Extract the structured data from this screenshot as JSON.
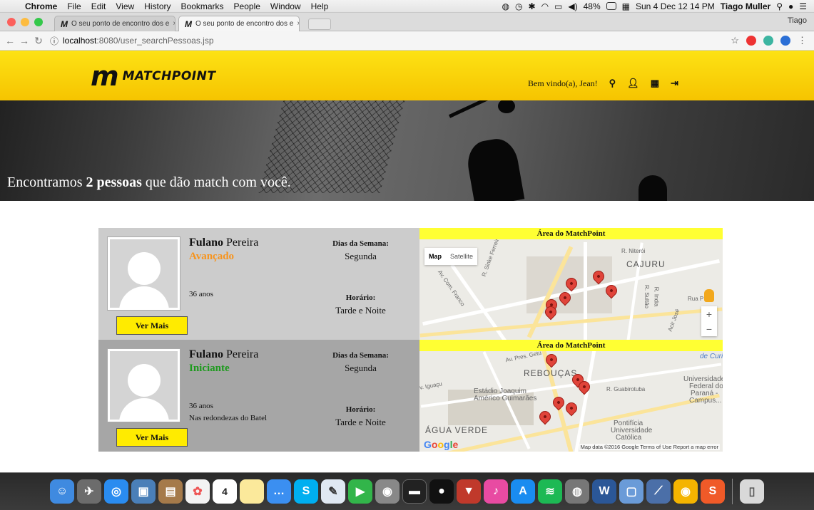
{
  "menubar": {
    "apple": "",
    "items": [
      "Chrome",
      "File",
      "Edit",
      "View",
      "History",
      "Bookmarks",
      "People",
      "Window",
      "Help"
    ],
    "battery": "48%",
    "datetime": "Sun 4 Dec 12 14 PM",
    "user": "Tiago Muller"
  },
  "browser": {
    "tabs": [
      {
        "favicon": "M",
        "title": "O seu ponto de encontro dos e"
      },
      {
        "favicon": "M",
        "title": "O seu ponto de encontro dos e"
      }
    ],
    "tab_close": "×",
    "profile": "Tiago",
    "url_host": "localhost",
    "url_path": ":8080/user_searchPessoas.jsp"
  },
  "header": {
    "logo_mark": "m",
    "logo_word": "MATCHPOINT",
    "greeting": "Bem vindo(a), Jean!",
    "icons": [
      "search-icon",
      "user-icon",
      "calendar-icon",
      "logout-icon"
    ]
  },
  "hero": {
    "prefix": "Encontramos ",
    "highlight": "2 pessoas",
    "suffix": " que dão match com você."
  },
  "results": [
    {
      "first_name": "Fulano",
      "last_name": " Pereira",
      "level": "Avançado",
      "level_color": "#f7941d",
      "age": "36 anos",
      "location": "",
      "days_label": "Dias da Semana:",
      "days": "Segunda",
      "time_label": "Horário:",
      "time": "Tarde e Noite",
      "button": "Ver Mais",
      "bg": "#cccccc",
      "map": {
        "title": "Área do MatchPoint",
        "type_map": "Map",
        "type_sat": "Satellite",
        "labels": [
          "CAJURU",
          "R. Niterói",
          "R. Sinke Ferreira",
          "Av. Com. Franco",
          "Rua P",
          "R. Sultão",
          "R. India",
          "Acir José"
        ],
        "zoom_in": "+",
        "zoom_out": "−"
      }
    },
    {
      "first_name": "Fulano",
      "last_name": " Pereira",
      "level": "Iniciante",
      "level_color": "#1e9a1e",
      "age": "36 anos",
      "location": "Nas redondezas do Batel",
      "days_label": "Dias da Semana:",
      "days": "Segunda",
      "time_label": "Horário:",
      "time": "Tarde e Noite",
      "button": "Ver Mais",
      "bg": "#a6a6a6",
      "map": {
        "title": "Área do MatchPoint",
        "labels": [
          "REBOUÇAS",
          "ÁGUA VERDE",
          "Estádio Joaquim",
          "Américo Guimarães",
          "Universidade",
          "Federal do",
          "Paraná -",
          "Campus...",
          "Pontifícia",
          "Universidade",
          "Católica",
          "de Curi",
          "R. Guabirotuba",
          "Av. Pres. Getú",
          "v. Iguaçu"
        ],
        "google": "Google",
        "attribution": "Map data ©2016 Google   Terms of Use   Report a map error"
      }
    }
  ],
  "dock": {
    "apps": [
      "finder-icon",
      "launchpad-icon",
      "safari-icon",
      "preview-icon",
      "contacts-icon",
      "photos-icon",
      "calendar-icon",
      "notes-icon",
      "messages-icon",
      "skype-icon",
      "textedit-icon",
      "facetime-icon",
      "sysprefs-icon",
      "terminal-icon",
      "camera-icon",
      "popcorn-icon",
      "itunes-icon",
      "appstore-icon",
      "spotify-icon",
      "disk-icon",
      "word-icon",
      "virtualbox-icon",
      "network-icon",
      "chrome-icon",
      "sublime-icon",
      "trash-icon"
    ],
    "calendar_day": "4"
  }
}
